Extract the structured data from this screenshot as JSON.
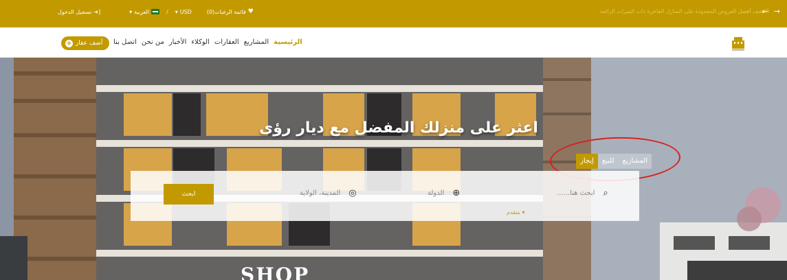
{
  "topbar": {
    "login": "تسجيل الدخول",
    "language": "العربية",
    "currency": "USD",
    "wishlist": "قائمة الرغبات(0)",
    "separator": "/",
    "marquee": "اكتشف أفضل العروض المحدودة على المنازل الفاخرة ذات الميزات الرائعة"
  },
  "nav": {
    "add_property": "أضف عقار",
    "items": [
      "الرئيسية",
      "المشاريع",
      "العقارات",
      "الوكلاء",
      "الأخبار",
      "من نحن",
      "اتصل بنا"
    ]
  },
  "hero": {
    "title": "اعثر على منزلك المفضل مع ديار رؤى",
    "tabs": [
      "المشاريع",
      "للبيع",
      "إيجار"
    ],
    "active_tab": "إيجار",
    "search": {
      "keyword_placeholder": "ابحث هنا......",
      "country_placeholder": "الدولة",
      "city_placeholder": "المدينة، الولاية",
      "button": "ابحث",
      "advanced": "متقدم ▾"
    },
    "sign_text": "SHOP"
  },
  "colors": {
    "accent": "#c29a00",
    "annotation": "#d81f1f"
  },
  "icons": [
    "sign-in-icon",
    "flag-icon",
    "heart-icon",
    "arrow-left-icon",
    "arrow-right-icon",
    "plus-circle-icon",
    "search-icon",
    "globe-icon",
    "location-target-icon",
    "logo"
  ]
}
